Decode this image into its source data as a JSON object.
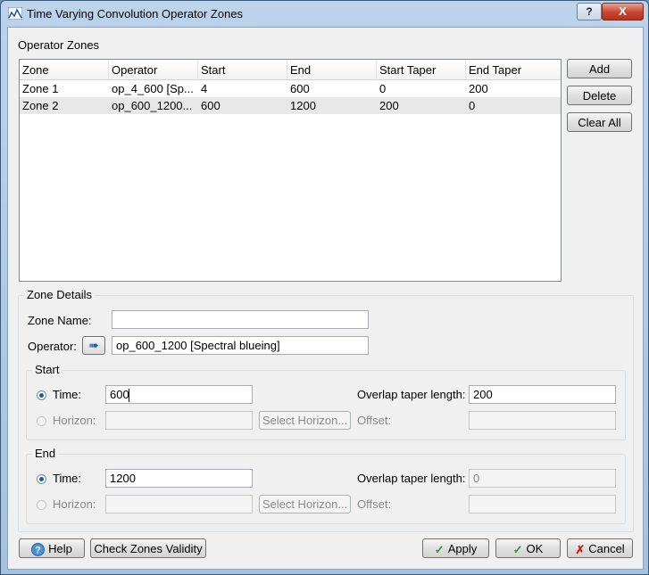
{
  "window": {
    "title": "Time Varying Convolution Operator Zones",
    "help_glyph": "?",
    "close_glyph": "X",
    "app_icon": "chart-icon"
  },
  "operator_zones": {
    "group_label": "Operator Zones",
    "columns": [
      "Zone",
      "Operator",
      "Start",
      "End",
      "Start Taper",
      "End Taper"
    ],
    "rows": [
      [
        "Zone 1",
        "op_4_600 [Sp...",
        "4",
        "600",
        "0",
        "200"
      ],
      [
        "Zone 2",
        "op_600_1200...",
        "600",
        "1200",
        "200",
        "0"
      ]
    ],
    "selected_row": 2
  },
  "side_buttons": {
    "add": "Add",
    "delete": "Delete",
    "clear_all": "Clear All"
  },
  "zone_details": {
    "group_label": "Zone Details",
    "zone_name_label": "Zone Name:",
    "zone_name_value": "",
    "operator_label": "Operator:",
    "operator_value": "op_600_1200 [Spectral blueing]",
    "operator_button_icon": "arrow-right-icon"
  },
  "start": {
    "group_label": "Start",
    "time_label": "Time:",
    "time_value": "600",
    "horizon_label": "Horizon:",
    "horizon_value": "",
    "select_horizon": "Select Horizon...",
    "overlap_label": "Overlap taper length:",
    "overlap_value": "200",
    "offset_label": "Offset:",
    "offset_value": "",
    "mode": "time"
  },
  "end": {
    "group_label": "End",
    "time_label": "Time:",
    "time_value": "1200",
    "horizon_label": "Horizon:",
    "horizon_value": "",
    "select_horizon": "Select Horizon...",
    "overlap_label": "Overlap taper length:",
    "overlap_value": "0",
    "offset_label": "Offset:",
    "offset_value": "",
    "mode": "time"
  },
  "footer": {
    "help": "Help",
    "check_validity": "Check Zones Validity",
    "apply": "Apply",
    "ok": "OK",
    "cancel": "Cancel"
  },
  "colors": {
    "selected_row": "#e8e8e8",
    "radio_dot": "#1f5aa8",
    "check_green": "#2e9a2e",
    "cancel_red": "#c8231b"
  }
}
